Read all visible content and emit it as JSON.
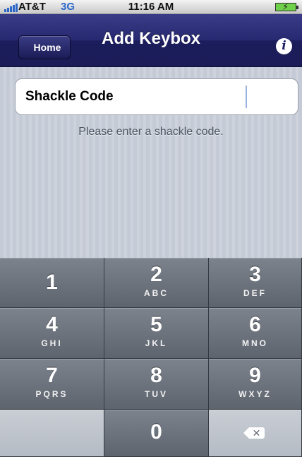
{
  "status_bar": {
    "carrier": "AT&T",
    "network": "3G",
    "time": "11:16 AM",
    "battery_icon": "battery-charging-icon",
    "signal_icon": "signal-bars-icon"
  },
  "nav": {
    "back_label": "Home",
    "title": "Add Keybox",
    "info_icon": "info-icon",
    "bar_color": "#26286f"
  },
  "form": {
    "field_label": "Shackle Code",
    "field_value": "",
    "hint": "Please enter a shackle code."
  },
  "keypad": {
    "keys": [
      {
        "num": "1",
        "letters": ""
      },
      {
        "num": "2",
        "letters": "ABC"
      },
      {
        "num": "3",
        "letters": "DEF"
      },
      {
        "num": "4",
        "letters": "GHI"
      },
      {
        "num": "5",
        "letters": "JKL"
      },
      {
        "num": "6",
        "letters": "MNO"
      },
      {
        "num": "7",
        "letters": "PQRS"
      },
      {
        "num": "8",
        "letters": "TUV"
      },
      {
        "num": "9",
        "letters": "WXYZ"
      },
      {
        "num": "",
        "letters": ""
      },
      {
        "num": "0",
        "letters": ""
      },
      {
        "num": "",
        "letters": ""
      }
    ],
    "delete_icon": "backspace-icon"
  }
}
